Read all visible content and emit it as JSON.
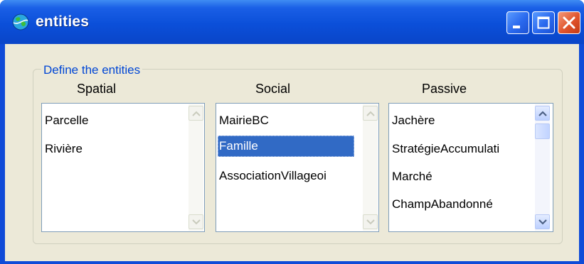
{
  "window": {
    "title": "entities",
    "icon": "globe-icon",
    "minimize_icon": "minimize-icon",
    "maximize_icon": "maximize-icon",
    "close_icon": "close-icon"
  },
  "group": {
    "legend": "Define the entities"
  },
  "columns": [
    {
      "header": "Spatial",
      "items": [
        "Parcelle",
        "Rivière"
      ],
      "selected": null,
      "scroll_enabled": false
    },
    {
      "header": "Social",
      "items": [
        "MairieBC",
        "Famille",
        "AssociationVillageoi"
      ],
      "selected": 1,
      "scroll_enabled": false
    },
    {
      "header": "Passive",
      "items": [
        "Jachère",
        "StratégieAccumulati",
        "Marché",
        "ChampAbandonné"
      ],
      "selected": null,
      "scroll_enabled": true
    }
  ],
  "colors": {
    "titlebar": "#0b4fd9",
    "selection": "#316ac5",
    "legend": "#0046d5",
    "client": "#ece9d8"
  }
}
